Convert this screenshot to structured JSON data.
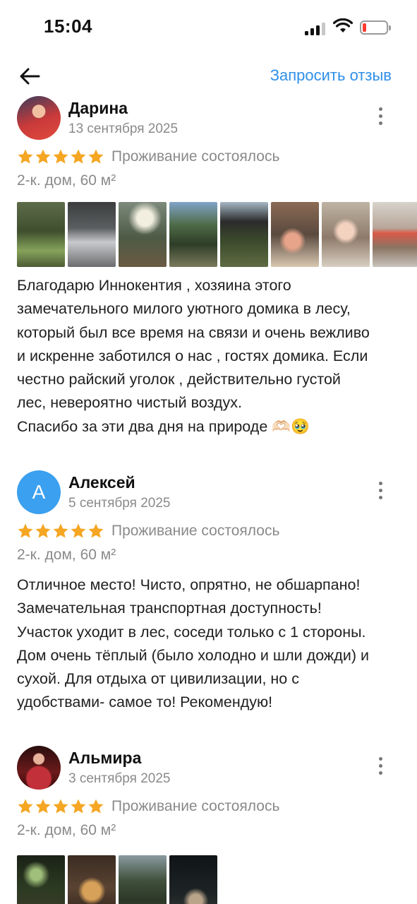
{
  "status_bar": {
    "time": "15:04"
  },
  "header": {
    "request_review_label": "Запросить отзыв"
  },
  "reviews": [
    {
      "author": "Дарина",
      "date": "13 сентября 2025",
      "stars": 5,
      "stay_status": "Проживание состоялось",
      "listing": "2-к. дом, 60 м²",
      "text": "Благодарю Иннокентия , хозяина этого\nзамечательного милого уютного домика в лесу,\nкоторый был все время на связи и очень вежливо\nи искренне заботился о нас , гостях домика. Если\nчестно райский уголок , действительно густой\nлес, невероятно чистый воздух.\nСпасибо за эти два дня на природе 🫶🏻🥹"
    },
    {
      "author": "Алексей",
      "avatar_letter": "А",
      "date": "5 сентября 2025",
      "stars": 5,
      "stay_status": "Проживание состоялось",
      "listing": "2-к. дом, 60 м²",
      "text": "Отличное место! Чисто, опрятно, не обшарпано!\nЗамечательная транспортная доступность!\nУчасток уходит в лес, соседи только с 1 стороны.\nДом очень тёплый (было холодно и шли дожди) и\nсухой. Для отдыха от цивилизации, но с\nудобствами- самое то! Рекомендую!"
    },
    {
      "author": "Альмира",
      "date": "3 сентября 2025",
      "stars": 5,
      "stay_status": "Проживание состоялось",
      "listing": "2-к. дом, 60 м²"
    }
  ],
  "colors": {
    "accent": "#2f8fe8",
    "star": "#f5a623",
    "muted": "#8a8a8a",
    "avatar_bg": "#3aa0ef"
  },
  "icons": [
    "back-arrow-icon",
    "more-vertical-icon",
    "star-icon",
    "signal-icon",
    "wifi-icon",
    "battery-icon"
  ]
}
